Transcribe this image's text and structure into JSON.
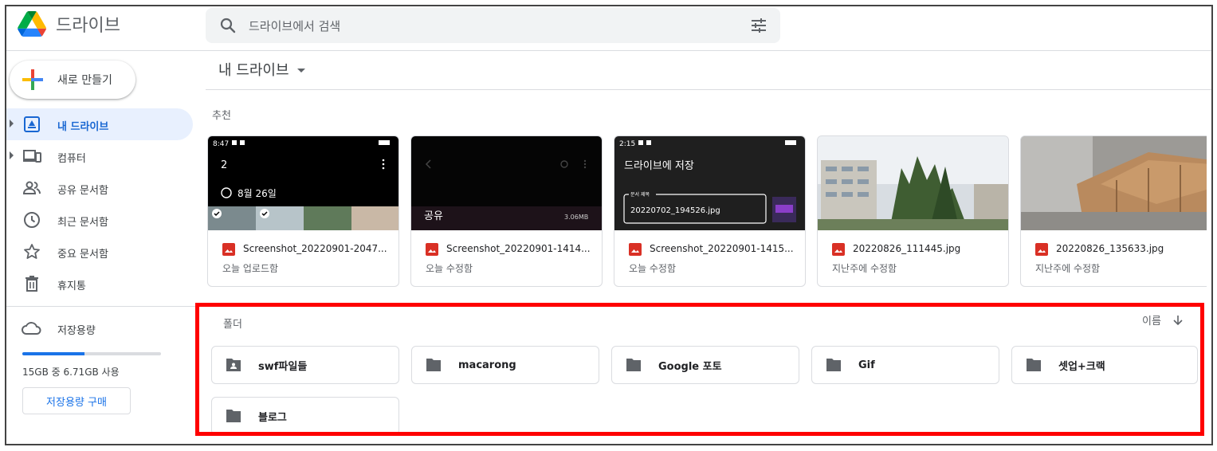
{
  "app": {
    "title": "드라이브"
  },
  "search": {
    "placeholder": "드라이브에서 검색"
  },
  "new_button": {
    "label": "새로 만들기"
  },
  "sidebar": {
    "items": [
      {
        "label": "내 드라이브",
        "icon": "my-drive-icon",
        "active": true,
        "expandable": true
      },
      {
        "label": "컴퓨터",
        "icon": "computers-icon",
        "active": false,
        "expandable": true
      },
      {
        "label": "공유 문서함",
        "icon": "people-icon",
        "active": false,
        "expandable": false
      },
      {
        "label": "최근 문서함",
        "icon": "clock-icon",
        "active": false,
        "expandable": false
      },
      {
        "label": "중요 문서함",
        "icon": "star-icon",
        "active": false,
        "expandable": false
      },
      {
        "label": "휴지통",
        "icon": "trash-icon",
        "active": false,
        "expandable": false
      }
    ],
    "storage": {
      "label": "저장용량",
      "usage": "15GB 중 6.71GB 사용",
      "used_fraction": 0.447,
      "buy_label": "저장용량 구매"
    }
  },
  "main": {
    "breadcrumb": "내 드라이브",
    "suggested": {
      "title": "추천",
      "cards": [
        {
          "name": "Screenshot_20220901-2047...",
          "subtitle": "오늘 업로드함",
          "kind": "image",
          "preview": {
            "time": "8:47",
            "title": "2",
            "date": "8월 26일"
          }
        },
        {
          "name": "Screenshot_20220901-1414...",
          "subtitle": "오늘 수정함",
          "kind": "image",
          "preview": {
            "label": "공유",
            "size": "3.06MB"
          }
        },
        {
          "name": "Screenshot_20220901-1415...",
          "subtitle": "오늘 수정함",
          "kind": "image",
          "preview": {
            "time": "2:15",
            "title": "드라이브에 저장",
            "field_label": "문서 제목",
            "field_value": "20220702_194526.jpg"
          }
        },
        {
          "name": "20220826_111445.jpg",
          "subtitle": "지난주에 수정함",
          "kind": "image"
        },
        {
          "name": "20220826_135633.jpg",
          "subtitle": "지난주에 수정함",
          "kind": "image"
        }
      ]
    },
    "folders": {
      "title": "폴더",
      "sort_label": "이름",
      "items": [
        {
          "name": "swf파일들",
          "shared": true
        },
        {
          "name": "macarong",
          "shared": false
        },
        {
          "name": "Google 포토",
          "shared": false
        },
        {
          "name": "Gif",
          "shared": false
        },
        {
          "name": "셋업+크랙",
          "shared": false
        },
        {
          "name": "블로그",
          "shared": false
        }
      ]
    }
  },
  "colors": {
    "accent": "#1a73e8",
    "active_bg": "#e8f0fe",
    "highlight_border": "#ff0000",
    "image_file_icon": "#d93025"
  }
}
